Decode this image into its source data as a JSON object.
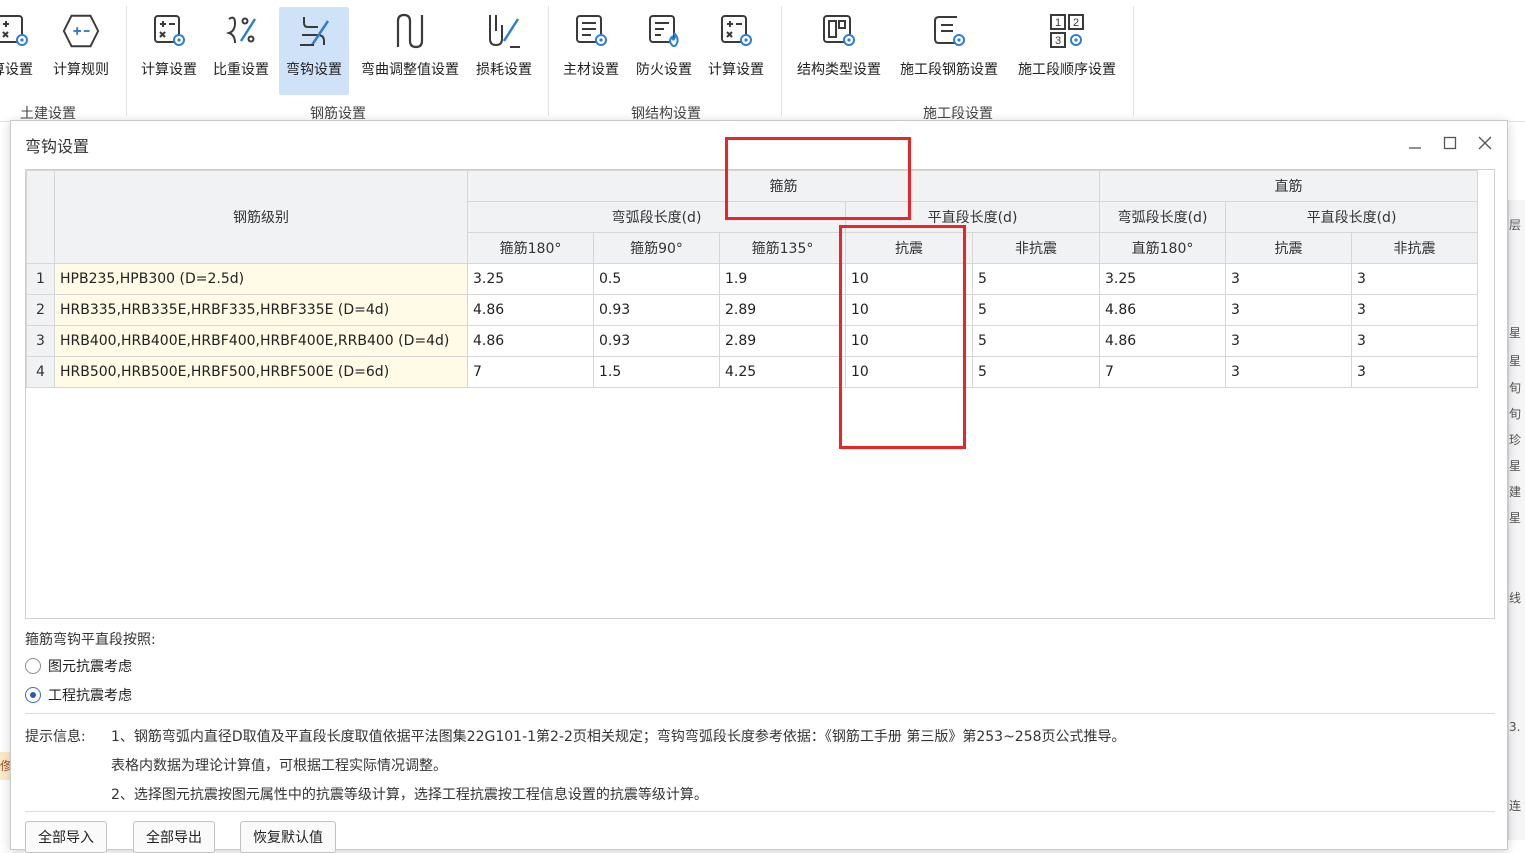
{
  "ribbon": {
    "groups": [
      {
        "title": "土建设置",
        "buttons": [
          {
            "label": "算设置",
            "icon": "calc-settings-icon"
          },
          {
            "label": "计算规则",
            "icon": "calc-rules-icon"
          }
        ]
      },
      {
        "title": "钢筋设置",
        "buttons": [
          {
            "label": "计算设置",
            "icon": "calc-settings-icon"
          },
          {
            "label": "比重设置",
            "icon": "density-settings-icon"
          },
          {
            "label": "弯钩设置",
            "icon": "hook-settings-icon",
            "active": true
          },
          {
            "label": "弯曲调整值设置",
            "icon": "bend-adjust-icon"
          },
          {
            "label": "损耗设置",
            "icon": "loss-settings-icon"
          }
        ]
      },
      {
        "title": "钢结构设置",
        "buttons": [
          {
            "label": "主材设置",
            "icon": "main-material-icon"
          },
          {
            "label": "防火设置",
            "icon": "fireproof-icon"
          },
          {
            "label": "计算设置",
            "icon": "calc-settings-icon"
          }
        ]
      },
      {
        "title": "施工段设置",
        "buttons": [
          {
            "label": "结构类型设置",
            "icon": "structure-type-icon"
          },
          {
            "label": "施工段钢筋设置",
            "icon": "segment-rebar-icon"
          },
          {
            "label": "施工段顺序设置",
            "icon": "segment-order-icon"
          }
        ]
      }
    ]
  },
  "dialog": {
    "title": "弯钩设置",
    "table": {
      "header": {
        "grade_col": "钢筋级别",
        "stirrup": "箍筋",
        "straight": "直筋",
        "stirrup_arc": "弯弧段长度(d)",
        "stirrup_flat": "平直段长度(d)",
        "straight_arc": "弯弧段长度(d)",
        "straight_flat": "平直段长度(d)",
        "cols": [
          "箍筋180°",
          "箍筋90°",
          "箍筋135°",
          "抗震",
          "非抗震",
          "直筋180°",
          "抗震",
          "非抗震"
        ]
      },
      "rows": [
        {
          "num": "1",
          "grade": "HPB235,HPB300 (D=2.5d)",
          "values": [
            "3.25",
            "0.5",
            "1.9",
            "10",
            "5",
            "3.25",
            "3",
            "3"
          ]
        },
        {
          "num": "2",
          "grade": "HRB335,HRB335E,HRBF335,HRBF335E (D=4d)",
          "values": [
            "4.86",
            "0.93",
            "2.89",
            "10",
            "5",
            "4.86",
            "3",
            "3"
          ]
        },
        {
          "num": "3",
          "grade": "HRB400,HRB400E,HRBF400,HRBF400E,RRB400 (D=4d)",
          "values": [
            "4.86",
            "0.93",
            "2.89",
            "10",
            "5",
            "4.86",
            "3",
            "3"
          ]
        },
        {
          "num": "4",
          "grade": "HRB500,HRB500E,HRBF500,HRBF500E (D=6d)",
          "values": [
            "7",
            "1.5",
            "4.25",
            "10",
            "5",
            "7",
            "3",
            "3"
          ]
        }
      ]
    },
    "options": {
      "title": "箍筋弯钩平直段按照:",
      "radios": [
        {
          "label": "图元抗震考虑",
          "checked": false
        },
        {
          "label": "工程抗震考虑",
          "checked": true
        }
      ]
    },
    "hints": {
      "label": "提示信息:",
      "line1": "1、钢筋弯弧内直径D取值及平直段长度取值依据平法图集22G101-1第2-2页相关规定；弯钩弯弧段长度参考依据：《钢筋工手册 第三版》第253~258页公式推导。",
      "line2": "表格内数据为理论计算值，可根据工程实际情况调整。",
      "line3": "2、选择图元抗震按图元属性中的抗震等级计算，选择工程抗震按工程信息设置的抗震等级计算。"
    },
    "buttons": {
      "import_all": "全部导入",
      "export_all": "全部导出",
      "restore": "恢复默认值"
    }
  },
  "background": {
    "right_chars": [
      "层",
      "星",
      "星",
      "旬",
      "旬",
      "珍",
      "星",
      "建",
      "星",
      "线",
      "3.",
      "连"
    ],
    "left_tag": "俢"
  },
  "colors": {
    "highlight_box": "#e8262a",
    "active_button_bg": "#cfe2f7",
    "grade_cell_bg": "#fffbe6",
    "icon_blue": "#2f7fd0"
  }
}
